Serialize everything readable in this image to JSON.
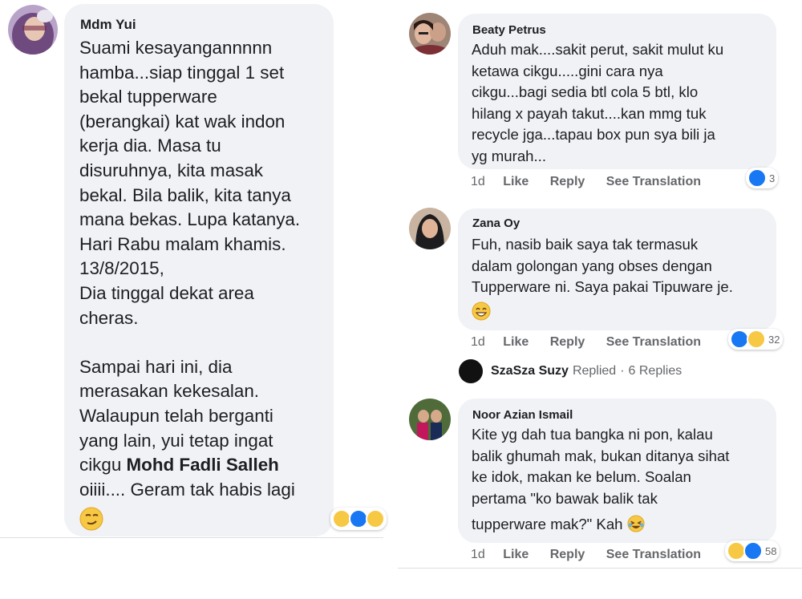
{
  "left": {
    "comment": {
      "author": "Mdm Yui",
      "lines": [
        "Suami kesayangannnnn",
        "hamba...siap tinggal 1 set",
        "bekal tupperware",
        "(berangkai) kat wak indon",
        "kerja dia. Masa tu",
        "disuruhnya, kita masak",
        "bekal. Bila balik, kita tanya",
        "mana bekas. Lupa katanya.",
        "Hari Rabu malam khamis.",
        "13/8/2015,",
        "Dia tinggal dekat area",
        "cheras.",
        "",
        "Sampai hari ini, dia",
        "merasakan kekesalan.",
        "Walaupun telah berganti",
        "yang lain, yui tetap ingat"
      ],
      "mention_prefix": "cikgu ",
      "mention": "Mohd Fadli Salleh",
      "last_line": "oiiii.... Geram tak habis lagi",
      "emoji": "smirk-emoji"
    }
  },
  "right": {
    "comments": [
      {
        "author": "Beaty Petrus",
        "lines": [
          "Aduh mak....sakit perut, sakit mulut ku",
          "ketawa cikgu.....gini cara nya",
          "cikgu...bagi sedia btl cola 5 btl, klo",
          "hilang x payah takut....kan mmg tuk",
          "recycle jga...tapau box pun sya bili ja",
          "yg murah..."
        ],
        "time": "1d",
        "like": "Like",
        "reply": "Reply",
        "translate": "See Translation",
        "reaction_count": "3"
      },
      {
        "author": "Zana Oy",
        "lines": [
          "Fuh, nasib baik saya tak termasuk",
          "dalam golongan yang obses dengan",
          "Tupperware ni. Saya pakai Tipuware je."
        ],
        "time": "1d",
        "like": "Like",
        "reply": "Reply",
        "translate": "See Translation",
        "reaction_count": "32"
      },
      {
        "author": "Noor Azian Ismail",
        "lines": [
          "Kite yg dah tua bangka ni pon, kalau",
          "balik ghumah mak, bukan ditanya sihat",
          "ke idok, makan ke belum. Soalan",
          "pertama \"ko bawak balik tak"
        ],
        "last_line": "tupperware mak?\" Kah",
        "time": "1d",
        "like": "Like",
        "reply": "Reply",
        "translate": "See Translation",
        "reaction_count": "58"
      }
    ],
    "replied": {
      "name": "SzaSza Suzy",
      "action": "Replied",
      "dot": "·",
      "replies": "6 Replies"
    }
  },
  "colors": {
    "bubble": "#f0f2f5",
    "text": "#1c1e21",
    "muted": "#65676b",
    "like_blue": "#1877f2",
    "emoji_yellow": "#f7c844"
  }
}
